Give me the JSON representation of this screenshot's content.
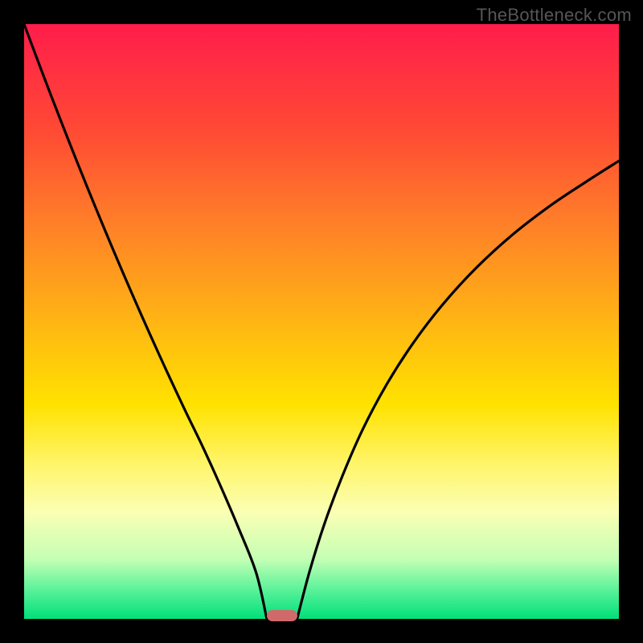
{
  "watermark": "TheBottleneck.com",
  "chart_data": {
    "type": "line",
    "title": "",
    "xlabel": "",
    "ylabel": "",
    "xlim": [
      0,
      1
    ],
    "ylim": [
      0,
      1
    ],
    "series": [
      {
        "name": "left-curve",
        "x": [
          0.0,
          0.03,
          0.06,
          0.09,
          0.12,
          0.15,
          0.18,
          0.21,
          0.24,
          0.27,
          0.3,
          0.33,
          0.36,
          0.39,
          0.408
        ],
        "y": [
          1.0,
          0.92,
          0.842,
          0.766,
          0.692,
          0.62,
          0.55,
          0.482,
          0.416,
          0.352,
          0.29,
          0.224,
          0.154,
          0.078,
          0.0
        ]
      },
      {
        "name": "right-curve",
        "x": [
          0.459,
          0.48,
          0.505,
          0.535,
          0.57,
          0.61,
          0.655,
          0.705,
          0.76,
          0.82,
          0.885,
          0.945,
          1.0
        ],
        "y": [
          0.0,
          0.08,
          0.16,
          0.24,
          0.32,
          0.395,
          0.465,
          0.53,
          0.59,
          0.645,
          0.695,
          0.735,
          0.77
        ]
      }
    ],
    "marker": {
      "x0": 0.408,
      "x1": 0.459,
      "y": 0.0
    },
    "gradient_stops": [
      {
        "pos": 0.0,
        "color": "#ff1d4b"
      },
      {
        "pos": 0.18,
        "color": "#ff4a34"
      },
      {
        "pos": 0.32,
        "color": "#ff7a2a"
      },
      {
        "pos": 0.5,
        "color": "#ffb514"
      },
      {
        "pos": 0.64,
        "color": "#ffe200"
      },
      {
        "pos": 0.74,
        "color": "#fff56a"
      },
      {
        "pos": 0.82,
        "color": "#fbffb4"
      },
      {
        "pos": 0.9,
        "color": "#c3ffb4"
      },
      {
        "pos": 0.95,
        "color": "#5cf29a"
      },
      {
        "pos": 1.0,
        "color": "#00e07a"
      }
    ]
  }
}
